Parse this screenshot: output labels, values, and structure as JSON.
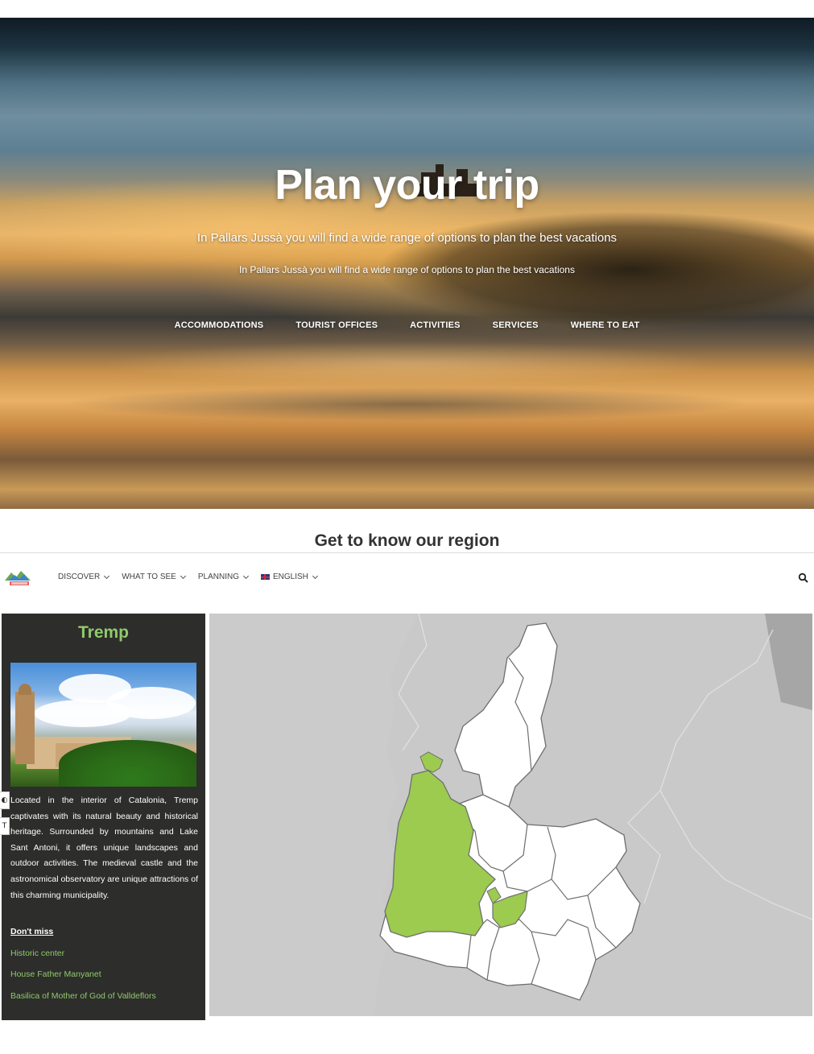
{
  "hero": {
    "title": "Plan your trip",
    "subtitle": "In Pallars Jussà you will find a wide range of options to plan the best vacations",
    "subtitle_small": "In Pallars Jussà you will find a wide range of options to plan the best vacations",
    "links": [
      "ACCOMMODATIONS",
      "TOURIST OFFICES",
      "ACTIVITIES",
      "SERVICES",
      "WHERE TO EAT"
    ]
  },
  "section": {
    "title": "Get to know our region"
  },
  "navbar": {
    "items": [
      "DISCOVER",
      "WHAT TO SEE",
      "PLANNING",
      "ENGLISH"
    ],
    "search_icon": "search-icon",
    "logo_icon": "site-logo"
  },
  "panel": {
    "title": "Tremp",
    "description": "Located in the interior of Catalonia, Tremp captivates with its natural beauty and historical heritage. Surrounded by mountains and Lake Sant Antoni, it offers unique landscapes and outdoor activities. The medieval castle and the astronomical observatory are unique attractions of this charming municipality.",
    "dont_miss_label": "Don't miss",
    "dont_miss_items": [
      "Historic center",
      "House Father Manyanet",
      "Basilica of Mother of God of Valldeflors"
    ]
  },
  "map": {
    "highlight_color": "#9ccb4f",
    "region_fill": "#ffffff",
    "outside_fill": "#c9c9c9",
    "selected": "Tremp"
  },
  "colors": {
    "panel_bg": "#2d2d2b",
    "accent_green": "#8fca6a"
  }
}
